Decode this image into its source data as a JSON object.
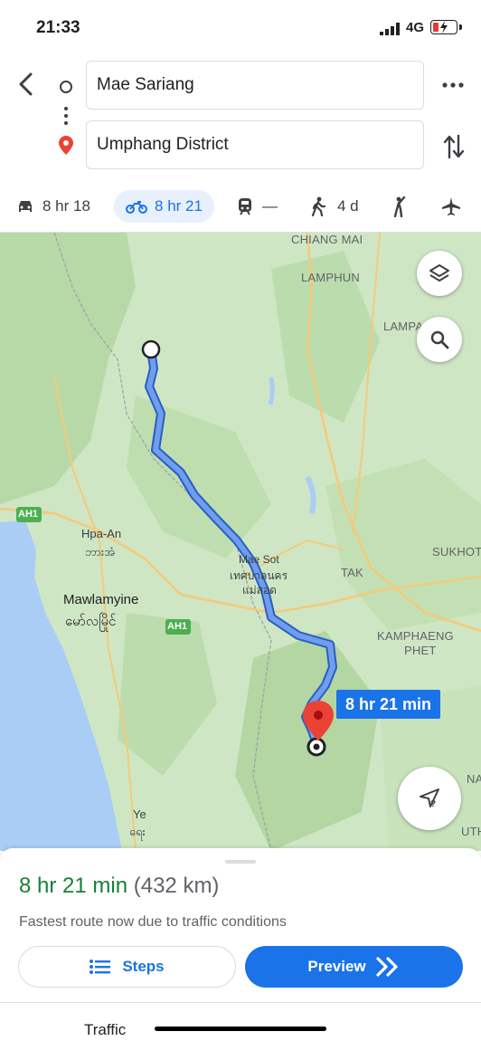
{
  "status_bar": {
    "time": "21:33",
    "network": "4G"
  },
  "directions": {
    "origin": "Mae Sariang",
    "destination": "Umphang District"
  },
  "modes": [
    {
      "name": "drive",
      "icon": "car-icon",
      "value": "8 hr 18"
    },
    {
      "name": "motorcycle",
      "icon": "motorcycle-icon",
      "value": "8 hr 21",
      "selected": true
    },
    {
      "name": "transit",
      "icon": "train-icon",
      "value": "—"
    },
    {
      "name": "walk",
      "icon": "walking-icon",
      "value": "4 d"
    },
    {
      "name": "ride",
      "icon": "ride-hail-icon",
      "value": ""
    },
    {
      "name": "flight",
      "icon": "airplane-icon",
      "value": ""
    }
  ],
  "map": {
    "route_label": "8 hr 21 min",
    "labels": {
      "chiang_mai": "CHIANG MAI",
      "lamphun": "LAMPHUN",
      "lampang": "LAMPA",
      "ah1_left": "AH1",
      "hpa_an": "Hpa-An",
      "hpa_an_my": "ဘားအံ",
      "mawlamyine": "Mawlamyine",
      "mawlamyine_my": "မော်လမြိုင်",
      "ah1_mid": "AH1",
      "mae_sot": "Mae Sot",
      "mae_sot_th1": "เทศบาลนคร",
      "mae_sot_th2": "แม่สอด",
      "tak": "TAK",
      "sukhothai": "SUKHOT",
      "kamphaeng1": "KAMPHAENG",
      "kamphaeng2": "PHET",
      "na": "NA",
      "ye": "Ye",
      "ye_my": "ရေး",
      "uth": "UTH"
    }
  },
  "route_summary": {
    "duration": "8 hr 21 min",
    "distance": "(432 km)",
    "reason": "Fastest route now due to traffic conditions",
    "steps_label": "Steps",
    "preview_label": "Preview"
  },
  "footer": {
    "traffic_label": "Traffic"
  },
  "colors": {
    "accent": "#1a73e8",
    "duration_green": "#188038",
    "route": "#4a7fe0",
    "map_base": "#cfe6c4"
  }
}
